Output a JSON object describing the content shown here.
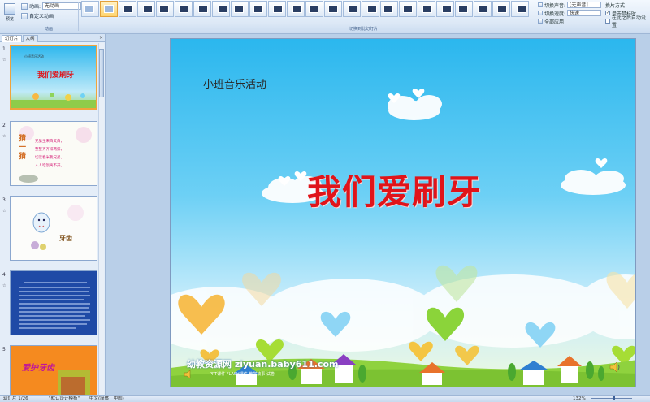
{
  "ribbon": {
    "preview_label": "预览",
    "animate_dropdown": "无动画",
    "anim_row1_label": "动画:",
    "custom_anim_label": "自定义动画",
    "animation_group_label": "动画",
    "transition_group_label": "切换到此幻灯片",
    "transition_sound_label": "切换声音:",
    "transition_sound_value": "[无声音]",
    "transition_speed_label": "切换速度:",
    "transition_speed_value": "快速",
    "apply_all_label": "全部应用",
    "advance_label": "换片方式",
    "on_click_label": "单击鼠标时",
    "after_label": "在此之后自动设置"
  },
  "left_pane": {
    "tab_slides": "幻灯片",
    "tab_outline": "大纲",
    "close": "×",
    "thumbs": [
      {
        "num": "1",
        "title": "我们爱刷牙",
        "subtitle": "小班音乐活动"
      },
      {
        "num": "2",
        "title": "猜一猜",
        "lines": [
          "兄弟生来白又白，",
          "整整齐齐排两排，",
          "切菜春米我兄弟，",
          "人人吃饭离不开。"
        ]
      },
      {
        "num": "3",
        "label": "牙齿"
      },
      {
        "num": "4",
        "title": ""
      },
      {
        "num": "5",
        "title": "爱护牙齿"
      }
    ]
  },
  "slide": {
    "subtitle": "小班音乐活动",
    "title": "我们爱刷牙",
    "watermark": "幼教资源网 ziyuan.baby611.com",
    "watermark_sub": "PPT课件   FLASH课件   教学故事   试卷"
  },
  "status": {
    "slide_count": "幻灯片 1/26",
    "theme": "\"默认设计模板\"",
    "lang": "中文(简体，中国)",
    "zoom": "132%",
    "zoom_level": 0.55
  },
  "colors": {
    "title_red": "#e0141a",
    "sel_orange": "#f0a43b"
  }
}
